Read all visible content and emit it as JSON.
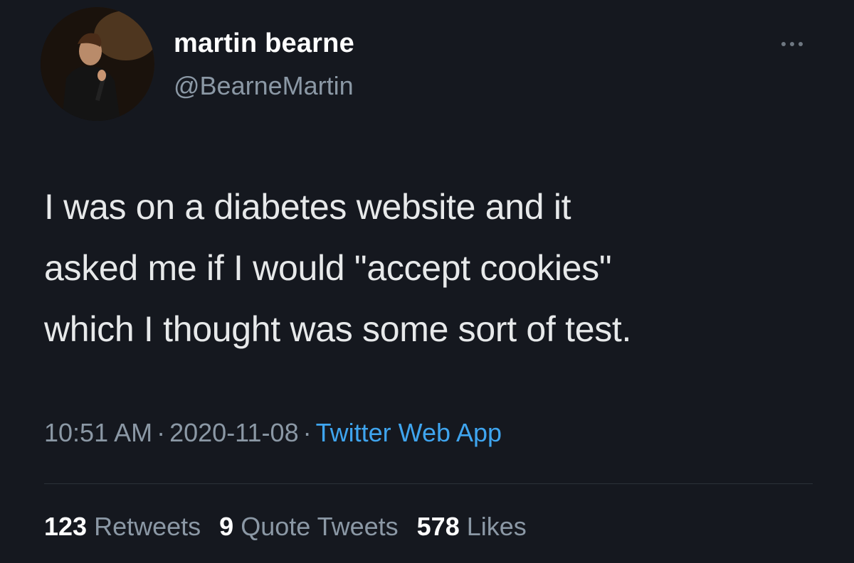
{
  "author": {
    "display_name": "martin bearne",
    "handle": "@BearneMartin"
  },
  "more_icon": "more-horizontal-icon",
  "tweet": {
    "lines": [
      "I was on a diabetes website and it",
      "asked me if I would \"accept cookies\"",
      "which I thought was some sort of test."
    ]
  },
  "meta": {
    "time": "10:51 AM",
    "separator": "·",
    "date": "2020-11-08",
    "source": "Twitter Web App"
  },
  "stats": {
    "retweets_count": "123",
    "retweets_label": "Retweets",
    "quotes_count": "9",
    "quotes_label": "Quote Tweets",
    "likes_count": "578",
    "likes_label": "Likes"
  },
  "colors": {
    "background": "#15181f",
    "primary_text": "#e7e9ea",
    "secondary_text": "#8b98a5",
    "link": "#3fa5ef"
  }
}
